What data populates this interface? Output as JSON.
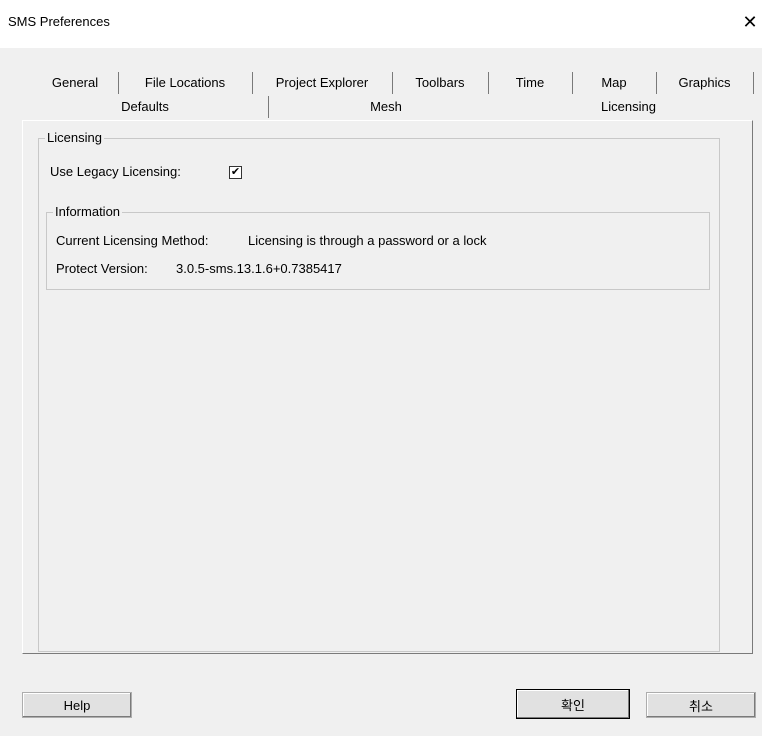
{
  "window": {
    "title": "SMS Preferences",
    "close_glyph": "✕"
  },
  "tabs_row1": [
    "General",
    "File Locations",
    "Project Explorer",
    "Toolbars",
    "Time",
    "Map",
    "Graphics"
  ],
  "tabs_row2": [
    "Defaults",
    "Mesh",
    "Licensing"
  ],
  "active_tab": "Licensing",
  "licensing_group": {
    "legend": "Licensing",
    "use_legacy_label": "Use Legacy Licensing:",
    "use_legacy_checked": true,
    "check_glyph": "✔"
  },
  "information_group": {
    "legend": "Information",
    "method_label": "Current Licensing Method:",
    "method_value": "Licensing is through a password or a lock",
    "version_label": "Protect Version:",
    "version_value": "3.0.5-sms.13.1.6+0.7385417"
  },
  "buttons": {
    "help": "Help",
    "ok": "확인",
    "cancel": "취소"
  }
}
